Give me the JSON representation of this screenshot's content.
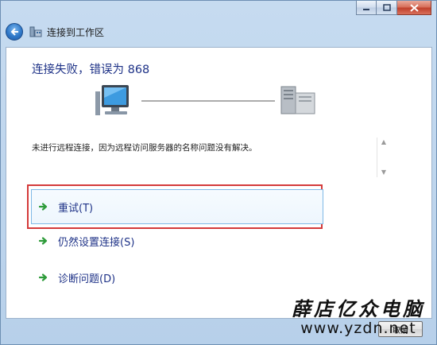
{
  "window": {
    "title": "连接到工作区",
    "controls": {
      "minimize": "minimize-icon",
      "maximize": "maximize-icon",
      "close": "close-icon"
    }
  },
  "content": {
    "heading": "连接失败，错误为 868",
    "message": "未进行远程连接，因为远程访问服务器的名称问题没有解决。",
    "options": [
      {
        "label": "重试(T)",
        "highlighted": true
      },
      {
        "label": "仍然设置连接(S)",
        "highlighted": false
      },
      {
        "label": "诊断问题(D)",
        "highlighted": false
      }
    ]
  },
  "footer": {
    "cancel_label": "取消"
  },
  "watermark": {
    "cn": "薛店亿众电脑",
    "url": "www.yzdn.net"
  },
  "colors": {
    "heading": "#1e3287",
    "highlight_border": "#d43a3a",
    "arrow": "#2e9b3a"
  }
}
